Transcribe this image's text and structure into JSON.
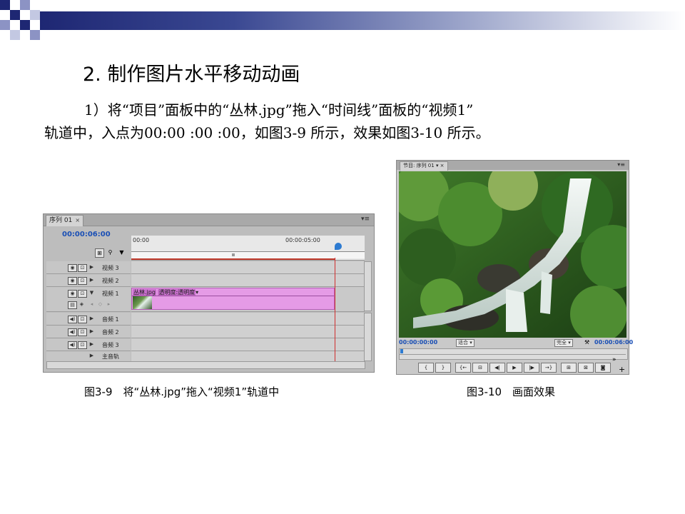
{
  "slide": {
    "title": "2. 制作图片水平移动动画",
    "para_line1": "1）将“项目”面板中的“丛林.jpg”拖入“时间线”面板的“视频1”",
    "para_line2": "轨道中，入点为00:00 :00 :00，如图3-9 所示，效果如图3-10 所示。",
    "caption_left": "图3-9　将“丛林.jpg”拖入“视频1”轨道中",
    "caption_right": "图3-10　画面效果",
    "header_colors": [
      "#1e2773",
      "#3a4892",
      "#9aa3c9"
    ]
  },
  "timeline": {
    "tab_label": "序列 01",
    "tab_close": "×",
    "menu_icon": "▾≡",
    "timecode": "00:00:06:00",
    "ruler_start": "00:00",
    "ruler_mid": "00:00:05:00",
    "tracks": [
      {
        "name": "视频 3",
        "kind": "video"
      },
      {
        "name": "视频 2",
        "kind": "video"
      },
      {
        "name": "视频 1",
        "kind": "video"
      },
      {
        "name": "音频 1",
        "kind": "audio"
      },
      {
        "name": "音频 2",
        "kind": "audio"
      },
      {
        "name": "音频 3",
        "kind": "audio"
      },
      {
        "name": "主音轨",
        "kind": "master"
      }
    ],
    "clip_name": "丛林.jpg",
    "clip_effect": "透明度:透明度",
    "clip_color": "#e59be6"
  },
  "monitor": {
    "tab_label": "节目: 序列 01",
    "menu_icon": "▾≡",
    "timecode_left": "00:00:00:00",
    "fit_label": "适合",
    "quality_label": "完全",
    "timecode_right": "00:00:06:00",
    "expand": "»",
    "add": "+"
  }
}
